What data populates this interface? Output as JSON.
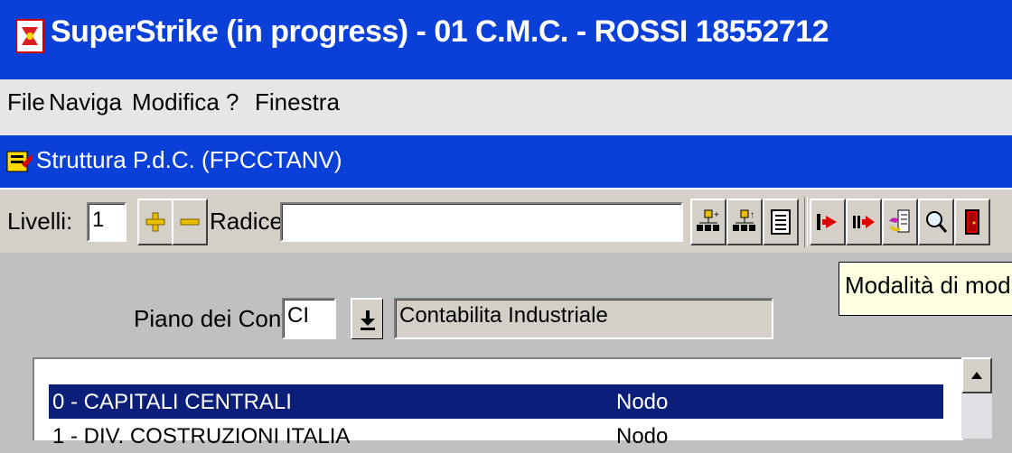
{
  "window": {
    "title": "SuperStrike (in progress) - 01 C.M.C. - ROSSI 18552712"
  },
  "menubar": {
    "items": [
      {
        "label": "File",
        "accel": "F"
      },
      {
        "label": "Naviga",
        "accel": "N"
      },
      {
        "label": "Modifica",
        "accel": "M"
      },
      {
        "label": "?",
        "accel": "?"
      },
      {
        "label": "Finestra",
        "accel": "F"
      }
    ]
  },
  "child_window": {
    "title": "Struttura P.d.C. (FPCCTANV)"
  },
  "toolbar": {
    "livelli_label": "Livelli:",
    "livelli_value": "1",
    "radice_label": "Radice:",
    "radice_value": ""
  },
  "form": {
    "piano_label": "Piano dei Conti :",
    "piano_code": "CI",
    "piano_description": "Contabilita Industriale"
  },
  "tooltip": {
    "text": "Modalità di modifica"
  },
  "list": {
    "rows": [
      {
        "name": "0 - CAPITALI CENTRALI",
        "type": "Nodo",
        "selected": true
      },
      {
        "name": "1 - DIV. COSTRUZIONI ITALIA",
        "type": "Nodo",
        "selected": false
      }
    ]
  },
  "colors": {
    "title_bar": "#0a3fd8",
    "selection": "#0a1e7a",
    "face": "#d4d0c8",
    "tooltip_bg": "#ffffe1"
  }
}
